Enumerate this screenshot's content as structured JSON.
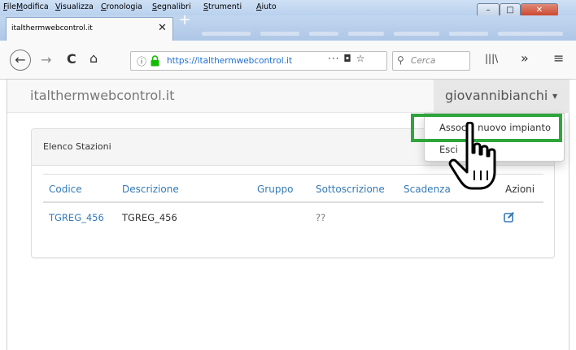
{
  "menubar": {
    "items": [
      "File",
      "Modifica",
      "Visualizza",
      "Cronologia",
      "Segnalibri",
      "Strumenti",
      "Aiuto"
    ]
  },
  "tab": {
    "title": "italthermwebcontrol.it",
    "close": "✕",
    "new": "+"
  },
  "window_controls": {
    "minimize": "–",
    "maximize": "□",
    "close": "✕"
  },
  "nav": {
    "url": "https://italthermwebcontrol.it",
    "page_actions": "··· ◘ ☆",
    "search_placeholder": "Cerca",
    "library": "|||\\",
    "overflow": "»",
    "menu": "≡"
  },
  "site": {
    "brand": "italthermwebcontrol.it",
    "user": "giovannibianchi",
    "dropdown": [
      "Associa nuovo impianto",
      "Esci"
    ]
  },
  "panel": {
    "title": "Elenco Stazioni",
    "columns": [
      "Codice",
      "Descrizione",
      "Gruppo",
      "Sottoscrizione",
      "Scadenza",
      "Azioni"
    ],
    "rows": [
      {
        "codice": "TGREG_456",
        "descrizione": "TGREG_456",
        "gruppo": "",
        "sottoscrizione": "??",
        "scadenza": ""
      }
    ]
  },
  "colors": {
    "link": "#337ab7",
    "highlight": "#2ea53a",
    "url": "#1f6fd0"
  }
}
